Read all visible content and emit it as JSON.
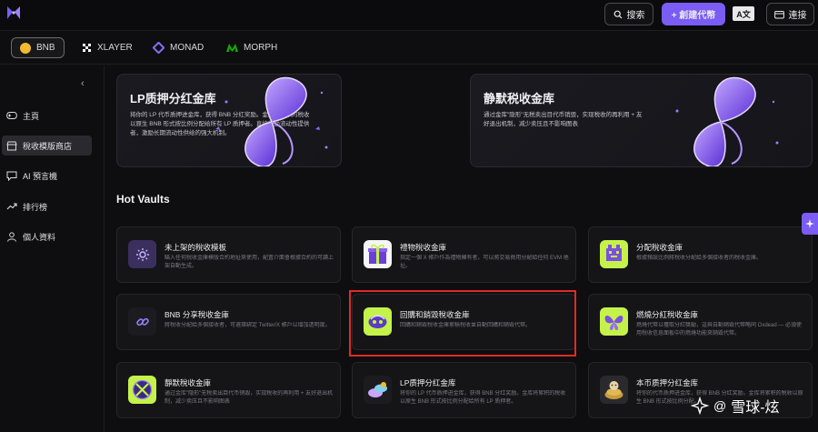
{
  "topbar": {
    "search_label": "搜索",
    "create_label": "+ 創建代幣",
    "lang_label": "A文",
    "connect_label": "連接",
    "accent": "#7b5cf5"
  },
  "chains": [
    {
      "label": "BNB",
      "icon": "bnb-coin-icon",
      "color": "#f3ba2f",
      "active": true
    },
    {
      "label": "XLAYER",
      "icon": "xlayer-icon",
      "color": "#ffffff"
    },
    {
      "label": "MONAD",
      "icon": "monad-icon",
      "color": "#836ef9"
    },
    {
      "label": "MORPH",
      "icon": "morph-icon",
      "color": "#14a800"
    }
  ],
  "sidebar": {
    "collapse_icon": "chevron-left-icon",
    "items": [
      {
        "label": "主頁",
        "icon": "gamepad-icon"
      },
      {
        "label": "稅收模版商店",
        "icon": "store-icon",
        "active": true
      },
      {
        "label": "AI 預言機",
        "icon": "chat-bubble-icon"
      },
      {
        "label": "排行榜",
        "icon": "trend-up-icon"
      },
      {
        "label": "個人資料",
        "icon": "user-icon"
      }
    ]
  },
  "banners": [
    {
      "title": "LP质押分红金库",
      "desc": "将你的 LP 代币质押进金库，获得 BNB 分红奖励。金库将累积的税收以原生 BNB 形式按比例分配给所有 LP 质押者。直接奖励流动性提供者，激励长期流动性供给的强大机制。"
    },
    {
      "title": "静默税收金库",
      "desc": "通过金库\"隐形\"无税卖出目代币销毁，实现税收的再利用 + 友好退出机制，减少卖压且不影响图表"
    }
  ],
  "section_title": "Hot Vaults",
  "vaults": [
    {
      "title": "未上架的稅收模板",
      "desc": "瞄入任何稅收金庫模版合約地址來使用，配置介面會根據合約的可讀上架自動生成。",
      "icon": "gear-icon"
    },
    {
      "title": "禮物稅收金庫",
      "desc": "指定一個 X 帳戶作為禮物擁有者，可以將交易費用分配給任何 EVM 地址。",
      "icon": "gift-icon"
    },
    {
      "title": "分配稅收金庫",
      "desc": "根據預設比例將稅收分配給多個接收者的稅收金庫。",
      "icon": "distribution-icon"
    },
    {
      "title": "BNB 分享稅收金庫",
      "desc": "將稅收分配給多個接收者，可選擇綁定 Twitter/X 帳戶以增加透明度。",
      "icon": "link-icon"
    },
    {
      "title": "回購和銷毀稅收金庫",
      "desc": "回購和銷毀稅收金庫累積稅收並自動回購和銷毀代幣。",
      "icon": "buyback-icon"
    },
    {
      "title": "燃燒分紅稅收金庫",
      "desc": "燃燒代幣以獲取分紅獎勵，這與自動銷毀代幣略同 Oxdead — 必須使用稅收信息面板中的燃燒功能來銷毀代幣。",
      "icon": "butterfly-icon"
    },
    {
      "title": "靜默稅收金庫",
      "desc": "通过金库\"隐形\"无税卖出目代币销毁，实现税收的再利用 + 友好退出机制，减少卖压且不影响图表",
      "icon": "silent-icon"
    },
    {
      "title": "LP质押分红金库",
      "desc": "将你的 LP 代币质押进金库，获得 BNB 分红奖励。金库将累积的税收以原生 BNB 形式按比例分配给所有 LP 质押者。",
      "icon": "lp-stake-icon"
    },
    {
      "title": "本币质押分红金库",
      "desc": "将你的代币质押进金库，获得 BNB 分红奖励。金库将累积的税收以原生 BNB 形式按比例分配。",
      "icon": "token-stake-icon"
    }
  ],
  "watermark": {
    "at": "@",
    "text": "雪球-炫"
  },
  "highlight_color": "#e02a2a"
}
